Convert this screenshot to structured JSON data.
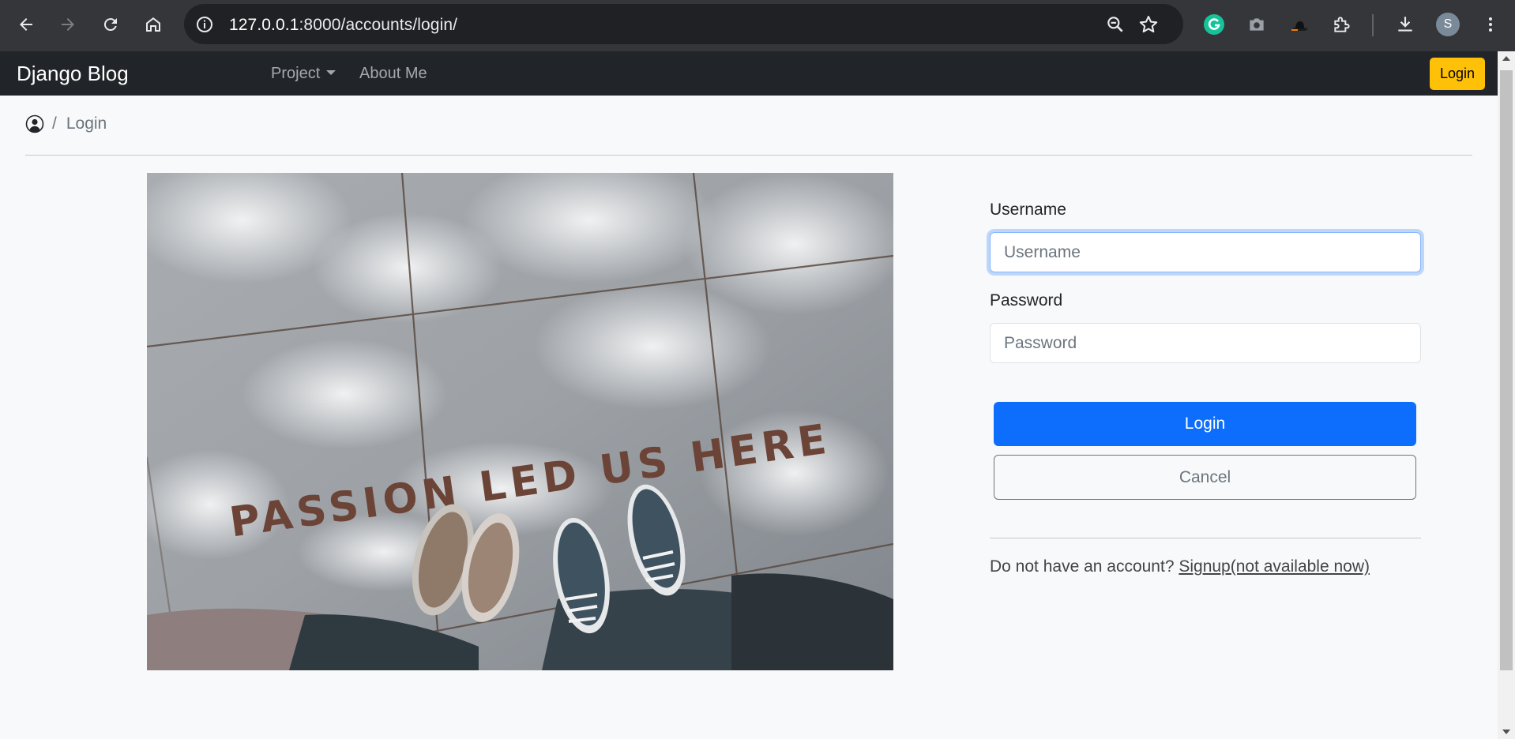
{
  "browser": {
    "url_host": "127.0.0.1",
    "url_rest": ":8000/accounts/login/",
    "profile_initial": "S"
  },
  "navbar": {
    "brand": "Django Blog",
    "project_label": "Project",
    "about_label": "About Me",
    "login_label": "Login"
  },
  "breadcrumb": {
    "current": "Login"
  },
  "photo": {
    "caption": "PASSION LED US HERE"
  },
  "form": {
    "username_label": "Username",
    "username_placeholder": "Username",
    "password_label": "Password",
    "password_placeholder": "Password",
    "login_button": "Login",
    "cancel_button": "Cancel",
    "signup_prompt": "Do not have an account? ",
    "signup_link": "Signup(not available now)"
  },
  "colors": {
    "navbar_bg": "#212529",
    "login_nav_btn": "#ffc107",
    "primary": "#0d6efd",
    "secondary": "#6c757d"
  }
}
